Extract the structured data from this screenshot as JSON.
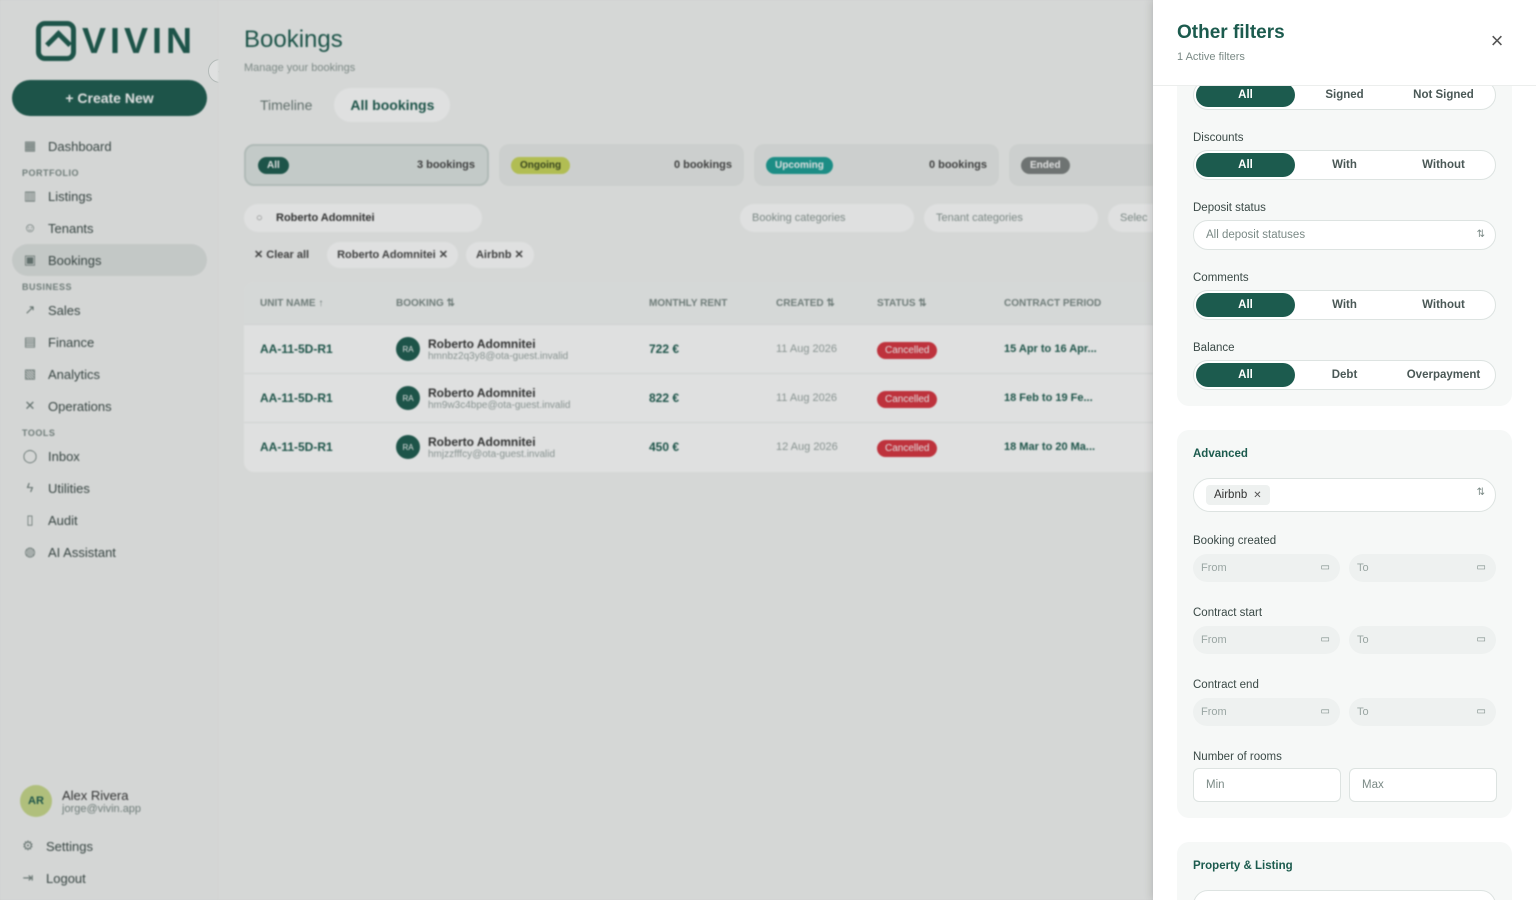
{
  "app": {
    "logo": "VIVIN",
    "create_label": "+ Create New"
  },
  "sidebar": {
    "sections": {
      "portfolio": "PORTFOLIO",
      "business": "BUSINESS",
      "tools": "TOOLS"
    },
    "items": {
      "dashboard": "Dashboard",
      "listings": "Listings",
      "tenants": "Tenants",
      "bookings": "Bookings",
      "sales": "Sales",
      "finance": "Finance",
      "analytics": "Analytics",
      "operations": "Operations",
      "inbox": "Inbox",
      "utilities": "Utilities",
      "audit": "Audit",
      "ai": "AI Assistant"
    },
    "user": {
      "initials": "AR",
      "name": "Alex Rivera",
      "email": "jorge@vivin.app"
    },
    "settings": "Settings",
    "logout": "Logout"
  },
  "main": {
    "title": "Bookings",
    "subtitle": "Manage your bookings",
    "tabs": [
      "Timeline",
      "All bookings"
    ],
    "stats": [
      {
        "label": "All",
        "count": "3 bookings",
        "color": "#1c5b4e",
        "text": "#ffffff"
      },
      {
        "label": "Ongoing",
        "count": "0 bookings",
        "color": "#c9d65a",
        "text": "#3b4a1a"
      },
      {
        "label": "Upcoming",
        "count": "0 bookings",
        "color": "#1a9e95",
        "text": "#ffffff"
      },
      {
        "label": "Ended",
        "count": "",
        "color": "#7b7f7e",
        "text": "#ffffff"
      }
    ],
    "search_value": "Roberto Adomnitei",
    "dropdowns": [
      "Booking categories",
      "Tenant categories",
      "Selec"
    ],
    "chips": {
      "clear": "Clear all",
      "guest": "Roberto Adomnitei",
      "source": "Airbnb"
    },
    "columns": [
      "UNIT NAME ↑",
      "BOOKING ⇅",
      "MONTHLY RENT",
      "CREATED ⇅",
      "STATUS ⇅",
      "CONTRACT PERIOD"
    ],
    "rows": [
      {
        "unit": "AA-11-5D-R1",
        "initials": "RA",
        "name": "Roberto Adomnitei",
        "email": "hmnbz2q3y8@ota-guest.invalid",
        "rent": "722 €",
        "created": "11 Aug 2026",
        "status": "Cancelled",
        "period": "15 Apr to 16 Apr..."
      },
      {
        "unit": "AA-11-5D-R1",
        "initials": "RA",
        "name": "Roberto Adomnitei",
        "email": "hm9w3c4bpe@ota-guest.invalid",
        "rent": "822 €",
        "created": "11 Aug 2026",
        "status": "Cancelled",
        "period": "18 Feb to 19 Fe..."
      },
      {
        "unit": "AA-11-5D-R1",
        "initials": "RA",
        "name": "Roberto Adomnitei",
        "email": "hmjzzfffcy@ota-guest.invalid",
        "rent": "450 €",
        "created": "12 Aug 2026",
        "status": "Cancelled",
        "period": "18 Mar to 20 Ma..."
      }
    ]
  },
  "panel": {
    "title": "Other filters",
    "subtitle": "1 Active filters",
    "signed": {
      "options": [
        "All",
        "Signed",
        "Not Signed"
      ],
      "selected": "All"
    },
    "discounts": {
      "label": "Discounts",
      "options": [
        "All",
        "With",
        "Without"
      ]
    },
    "deposit": {
      "label": "Deposit status",
      "placeholder": "All deposit statuses"
    },
    "comments": {
      "label": "Comments",
      "options": [
        "All",
        "With",
        "Without"
      ]
    },
    "balance": {
      "label": "Balance",
      "options": [
        "All",
        "Debt",
        "Overpayment"
      ]
    },
    "advanced": {
      "title": "Advanced",
      "tag": "Airbnb",
      "booking_created": "Booking created",
      "contract_start": "Contract start",
      "contract_end": "Contract end",
      "from": "From",
      "to": "To",
      "rooms": "Number of rooms",
      "min": "Min",
      "max": "Max"
    },
    "property_title": "Property & Listing"
  }
}
